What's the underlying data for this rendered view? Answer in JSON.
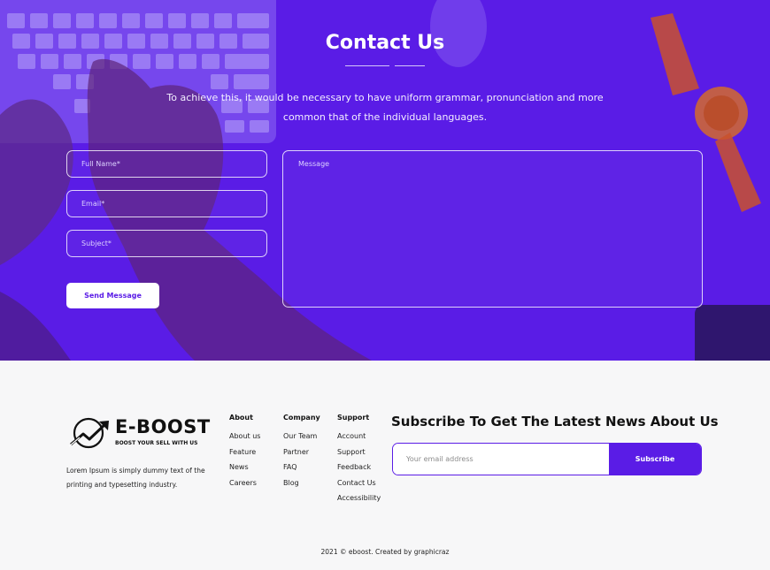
{
  "contact": {
    "title": "Contact Us",
    "description": "To achieve this, it would be necessary to have uniform grammar, pronunciation and more common that of the individual languages.",
    "fields": {
      "full_name_placeholder": "Full Name*",
      "email_placeholder": "Email*",
      "subject_placeholder": "Subject*",
      "message_placeholder": "Message"
    },
    "send_label": "Send Message"
  },
  "footer": {
    "brand": {
      "name": "E-BOOST",
      "tagline": "BOOST YOUR SELL WITH US",
      "description": "Lorem Ipsum is simply dummy text of the printing and typesetting industry."
    },
    "columns": [
      {
        "title": "About",
        "links": [
          "About us",
          "Feature",
          "News",
          "Careers"
        ]
      },
      {
        "title": "Company",
        "links": [
          "Our Team",
          "Partner",
          "FAQ",
          "Blog"
        ]
      },
      {
        "title": "Support",
        "links": [
          "Account",
          "Support",
          "Feedback",
          "Contact Us",
          "Accessibility"
        ]
      }
    ],
    "subscribe": {
      "heading_bold": "Subscribe",
      "heading_rest": " To Get The Latest News About Us",
      "input_placeholder": "Your email address",
      "button_label": "Subscribe"
    },
    "copyright": "2021 © eboost. Created by graphicraz"
  },
  "colors": {
    "accent": "#5a1ce6",
    "hero_overlay": "#5a1ce6",
    "footer_bg": "#f7f7f8"
  },
  "icons": {
    "logo": "trending-up-arrow-logo-icon"
  }
}
